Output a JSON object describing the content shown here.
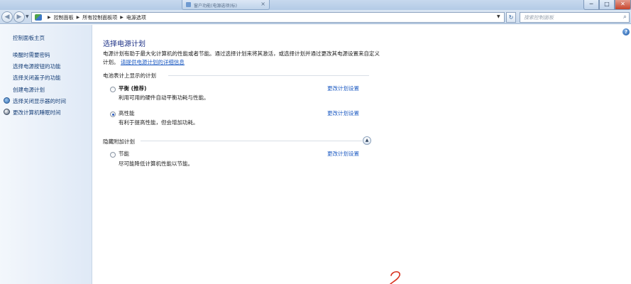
{
  "titlebar": {
    "background_tab_title": "窗户功能(电源选项(标)"
  },
  "window_controls": {
    "minimize": "─",
    "maximize": "□",
    "close": "✕"
  },
  "address_bar": {
    "crumbs": [
      "控制面板",
      "所有控制面板项",
      "电源选项"
    ],
    "search_placeholder": "搜索控制面板"
  },
  "sidebar": {
    "home_link": "控制面板主页",
    "links": [
      "唤醒时需要密码",
      "选择电源按钮的功能",
      "选择关闭盖子的功能",
      "创建电源计划",
      "选择关闭显示器的时间",
      "更改计算机睡眠时间"
    ]
  },
  "main": {
    "title": "选择电源计划",
    "description": "电源计划有助于最大化计算机的性能或者节能。通过选择计划来将其激活，或选择计划并通过更改其电源设置来自定义计划。",
    "description_link": "请提供电源计划的详细信息",
    "group_battery": "电池表计上显示的计划",
    "group_hidden": "隐藏附加计划",
    "change_settings_label": "更改计划设置",
    "plans": [
      {
        "name": "平衡 (推荐)",
        "desc": "利用可用的硬件自动平衡功耗与性能。",
        "selected": false
      },
      {
        "name": "高性能",
        "desc": "有利于提高性能，但会增加功耗。",
        "selected": true
      },
      {
        "name": "节能",
        "desc": "尽可能降低计算机性能以节能。",
        "selected": false
      }
    ]
  },
  "colors": {
    "title_blue": "#1e3287",
    "link_blue": "#1f5cc3",
    "annotation_red": "#d8301d"
  },
  "icons": {
    "back": "back-arrow-icon",
    "forward": "forward-arrow-icon",
    "refresh": "refresh-icon",
    "search": "search-icon",
    "help": "help-icon"
  }
}
